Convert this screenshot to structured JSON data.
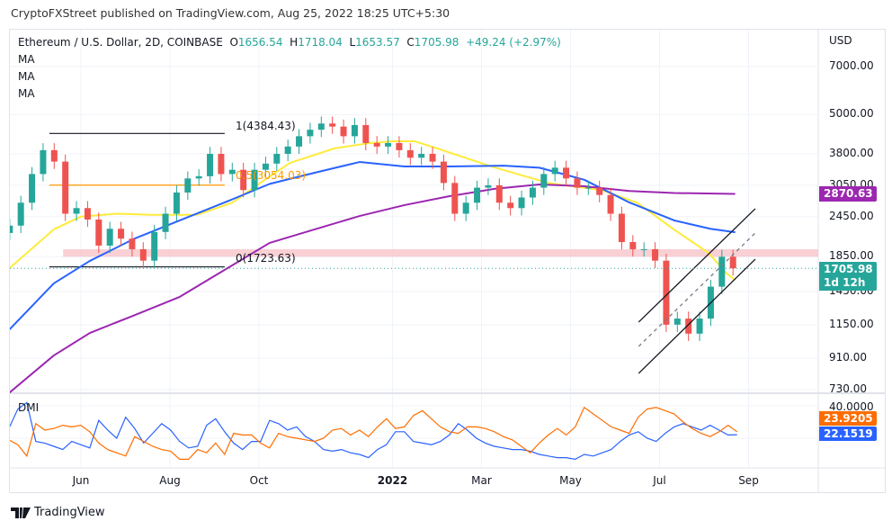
{
  "header": {
    "published": "CryptoFXStreet published on TradingView.com, Aug 25, 2022 18:25 UTC+5:30"
  },
  "legend": {
    "symbol": "Ethereum / U.S. Dollar, 2D, COINBASE",
    "o_label": "O",
    "o": "1656.54",
    "h_label": "H",
    "h": "1718.04",
    "l_label": "L",
    "l": "1653.57",
    "c_label": "C",
    "c": "1705.98",
    "change": "+49.24 (+2.97%)",
    "indicators": [
      "MA",
      "MA",
      "MA"
    ],
    "dmi": "DMI"
  },
  "axis": {
    "currency": "USD",
    "price_ticks": [
      "7000.00",
      "5000.00",
      "3800.00",
      "3050.00",
      "2450.00",
      "1850.00",
      "1450.00",
      "1150.00",
      "910.00",
      "730.00"
    ],
    "dmi_tick": "40.0000",
    "badges": {
      "ma_purple": "2870.63",
      "last_price": "1705.98",
      "countdown": "1d 12h",
      "dmi_orange": "23.9205",
      "dmi_blue": "22.1519"
    },
    "time_ticks": [
      {
        "label": "Jun",
        "month": 5
      },
      {
        "label": "Aug",
        "month": 7
      },
      {
        "label": "Oct",
        "month": 9
      },
      {
        "label": "2022",
        "month": 12,
        "bold": true
      },
      {
        "label": "Mar",
        "month": 14
      },
      {
        "label": "May",
        "month": 16
      },
      {
        "label": "Jul",
        "month": 18
      },
      {
        "label": "Sep",
        "month": 20
      }
    ]
  },
  "footer": {
    "brand": "TradingView"
  },
  "colors": {
    "up": "#26a69a",
    "down": "#ef5350",
    "ma_fast": "#ffeb3b",
    "ma_mid": "#2962ff",
    "ma_slow": "#9c27b0",
    "dmi_plus": "#2962ff",
    "dmi_minus": "#ff6d00",
    "zone": "#f8c8cc",
    "fib_mid": "#ff9800"
  },
  "chart_data": {
    "type": "candlestick",
    "x_unit": "months since Jan 2021",
    "y_scale": "log",
    "ylim": [
      730,
      7000
    ],
    "candles": {
      "x_start": 3.4,
      "x_step": 0.25,
      "close": [
        2300,
        2700,
        3300,
        3900,
        3600,
        2500,
        2600,
        2400,
        2000,
        2250,
        2100,
        1950,
        1800,
        2200,
        2500,
        2900,
        3200,
        3250,
        3800,
        3300,
        3400,
        2950,
        3400,
        3550,
        3800,
        4000,
        4300,
        4500,
        4700,
        4600,
        4300,
        4650,
        4100,
        4000,
        4100,
        3900,
        3700,
        3800,
        3600,
        3100,
        2500,
        2700,
        3000,
        3050,
        2700,
        2600,
        2800,
        3000,
        3300,
        3450,
        3200,
        3000,
        3000,
        2850,
        2500,
        2050,
        1950,
        1950,
        1800,
        1150,
        1200,
        1080,
        1200,
        1500,
        1850,
        1705.98
      ]
    },
    "moving_averages": [
      {
        "name": "MA fast",
        "color": "#ffeb3b",
        "points": [
          [
            3.38,
            1700
          ],
          [
            4.39,
            2240
          ],
          [
            5.0,
            2450
          ],
          [
            5.8,
            2500
          ],
          [
            6.6,
            2480
          ],
          [
            7.6,
            2480
          ],
          [
            8.4,
            2700
          ],
          [
            9.1,
            3150
          ],
          [
            9.7,
            3570
          ],
          [
            10.7,
            3950
          ],
          [
            11.5,
            4100
          ],
          [
            12.0,
            4150
          ],
          [
            12.5,
            4150
          ],
          [
            13.0,
            3950
          ],
          [
            14.25,
            3470
          ],
          [
            15.5,
            3100
          ],
          [
            16.7,
            2950
          ],
          [
            17.5,
            2700
          ],
          [
            18.3,
            2250
          ],
          [
            19.1,
            1900
          ],
          [
            19.5,
            1650
          ],
          [
            19.7,
            1570
          ]
        ]
      },
      {
        "name": "MA mid",
        "color": "#2962ff",
        "points": [
          [
            3.38,
            1107
          ],
          [
            4.39,
            1535
          ],
          [
            5.2,
            1797
          ],
          [
            6.21,
            2102
          ],
          [
            7.22,
            2385
          ],
          [
            8.23,
            2705
          ],
          [
            9.24,
            3080
          ],
          [
            10.25,
            3330
          ],
          [
            11.26,
            3590
          ],
          [
            12.27,
            3480
          ],
          [
            13.28,
            3480
          ],
          [
            14.5,
            3500
          ],
          [
            15.3,
            3450
          ],
          [
            16.31,
            3170
          ],
          [
            17.32,
            2705
          ],
          [
            18.33,
            2385
          ],
          [
            19.14,
            2250
          ],
          [
            19.7,
            2195
          ]
        ]
      },
      {
        "name": "MA slow",
        "color": "#9c27b0",
        "points": [
          [
            3.38,
            712
          ],
          [
            4.39,
            927
          ],
          [
            5.2,
            1085
          ],
          [
            6.21,
            1230
          ],
          [
            7.22,
            1397
          ],
          [
            8.23,
            1688
          ],
          [
            9.24,
            2038
          ],
          [
            10.25,
            2240
          ],
          [
            11.26,
            2460
          ],
          [
            12.27,
            2655
          ],
          [
            13.28,
            2826
          ],
          [
            14.29,
            2975
          ],
          [
            15.3,
            3068
          ],
          [
            16.31,
            3030
          ],
          [
            17.32,
            2930
          ],
          [
            18.33,
            2890
          ],
          [
            19.7,
            2870.63
          ]
        ]
      }
    ],
    "fibonacci": {
      "x_range": [
        4.29,
        8.23
      ],
      "levels": [
        {
          "label": "1(4384.43)",
          "price": 4384.43
        },
        {
          "label": "0.5(3054.03)",
          "price": 3054.03
        },
        {
          "label": "0(1723.63)",
          "price": 1723.63
        }
      ]
    },
    "resistance_zone": {
      "low": 1850,
      "high": 1950,
      "x_start": 4.6
    },
    "channel": {
      "upper": [
        [
          17.53,
          1171
        ],
        [
          20.15,
          2589
        ]
      ],
      "middle": [
        [
          17.53,
          988
        ],
        [
          20.15,
          2184
        ]
      ],
      "lower": [
        [
          17.53,
          818
        ],
        [
          20.15,
          1818
        ]
      ]
    },
    "last_price": 1705.98,
    "dmi": {
      "ylim": [
        0,
        40
      ],
      "x_start": 3.38,
      "x_step": 0.202,
      "series": [
        {
          "name": "+DI",
          "color": "#2962ff",
          "values": [
            26,
            38,
            42,
            18,
            17,
            15,
            13,
            18,
            16,
            14,
            31,
            25,
            20,
            33,
            26,
            17,
            23,
            29,
            25,
            18,
            14,
            15,
            28,
            32,
            24,
            17,
            13,
            18,
            18,
            31,
            29,
            25,
            27,
            21,
            18,
            13,
            12,
            13,
            11,
            10,
            8,
            13,
            16,
            24,
            24,
            18,
            17,
            16,
            18,
            22,
            29,
            25,
            20,
            17,
            15,
            14,
            13,
            13,
            12,
            10,
            9,
            8,
            8,
            7,
            10,
            9,
            11,
            13,
            18,
            22,
            24,
            20,
            18,
            23,
            27,
            29,
            27,
            25,
            28,
            25,
            22,
            22.15
          ]
        },
        {
          "name": "-DI",
          "color": "#ff6d00",
          "values": [
            19,
            16,
            9,
            29,
            25,
            26,
            28,
            27,
            28,
            24,
            17,
            13,
            11,
            9,
            21,
            18,
            15,
            13,
            12,
            7,
            7,
            13,
            11,
            17,
            10,
            23,
            22,
            22,
            17,
            14,
            23,
            21,
            20,
            19,
            18,
            20,
            25,
            26,
            22,
            25,
            21,
            27,
            32,
            26,
            27,
            34,
            37,
            32,
            27,
            24,
            23,
            27,
            27,
            26,
            24,
            21,
            19,
            15,
            11,
            17,
            22,
            26,
            22,
            27,
            39,
            35,
            31,
            27,
            25,
            23,
            33,
            38,
            39,
            37,
            35,
            30,
            26,
            23,
            21,
            24,
            28,
            23.92
          ]
        }
      ]
    }
  }
}
